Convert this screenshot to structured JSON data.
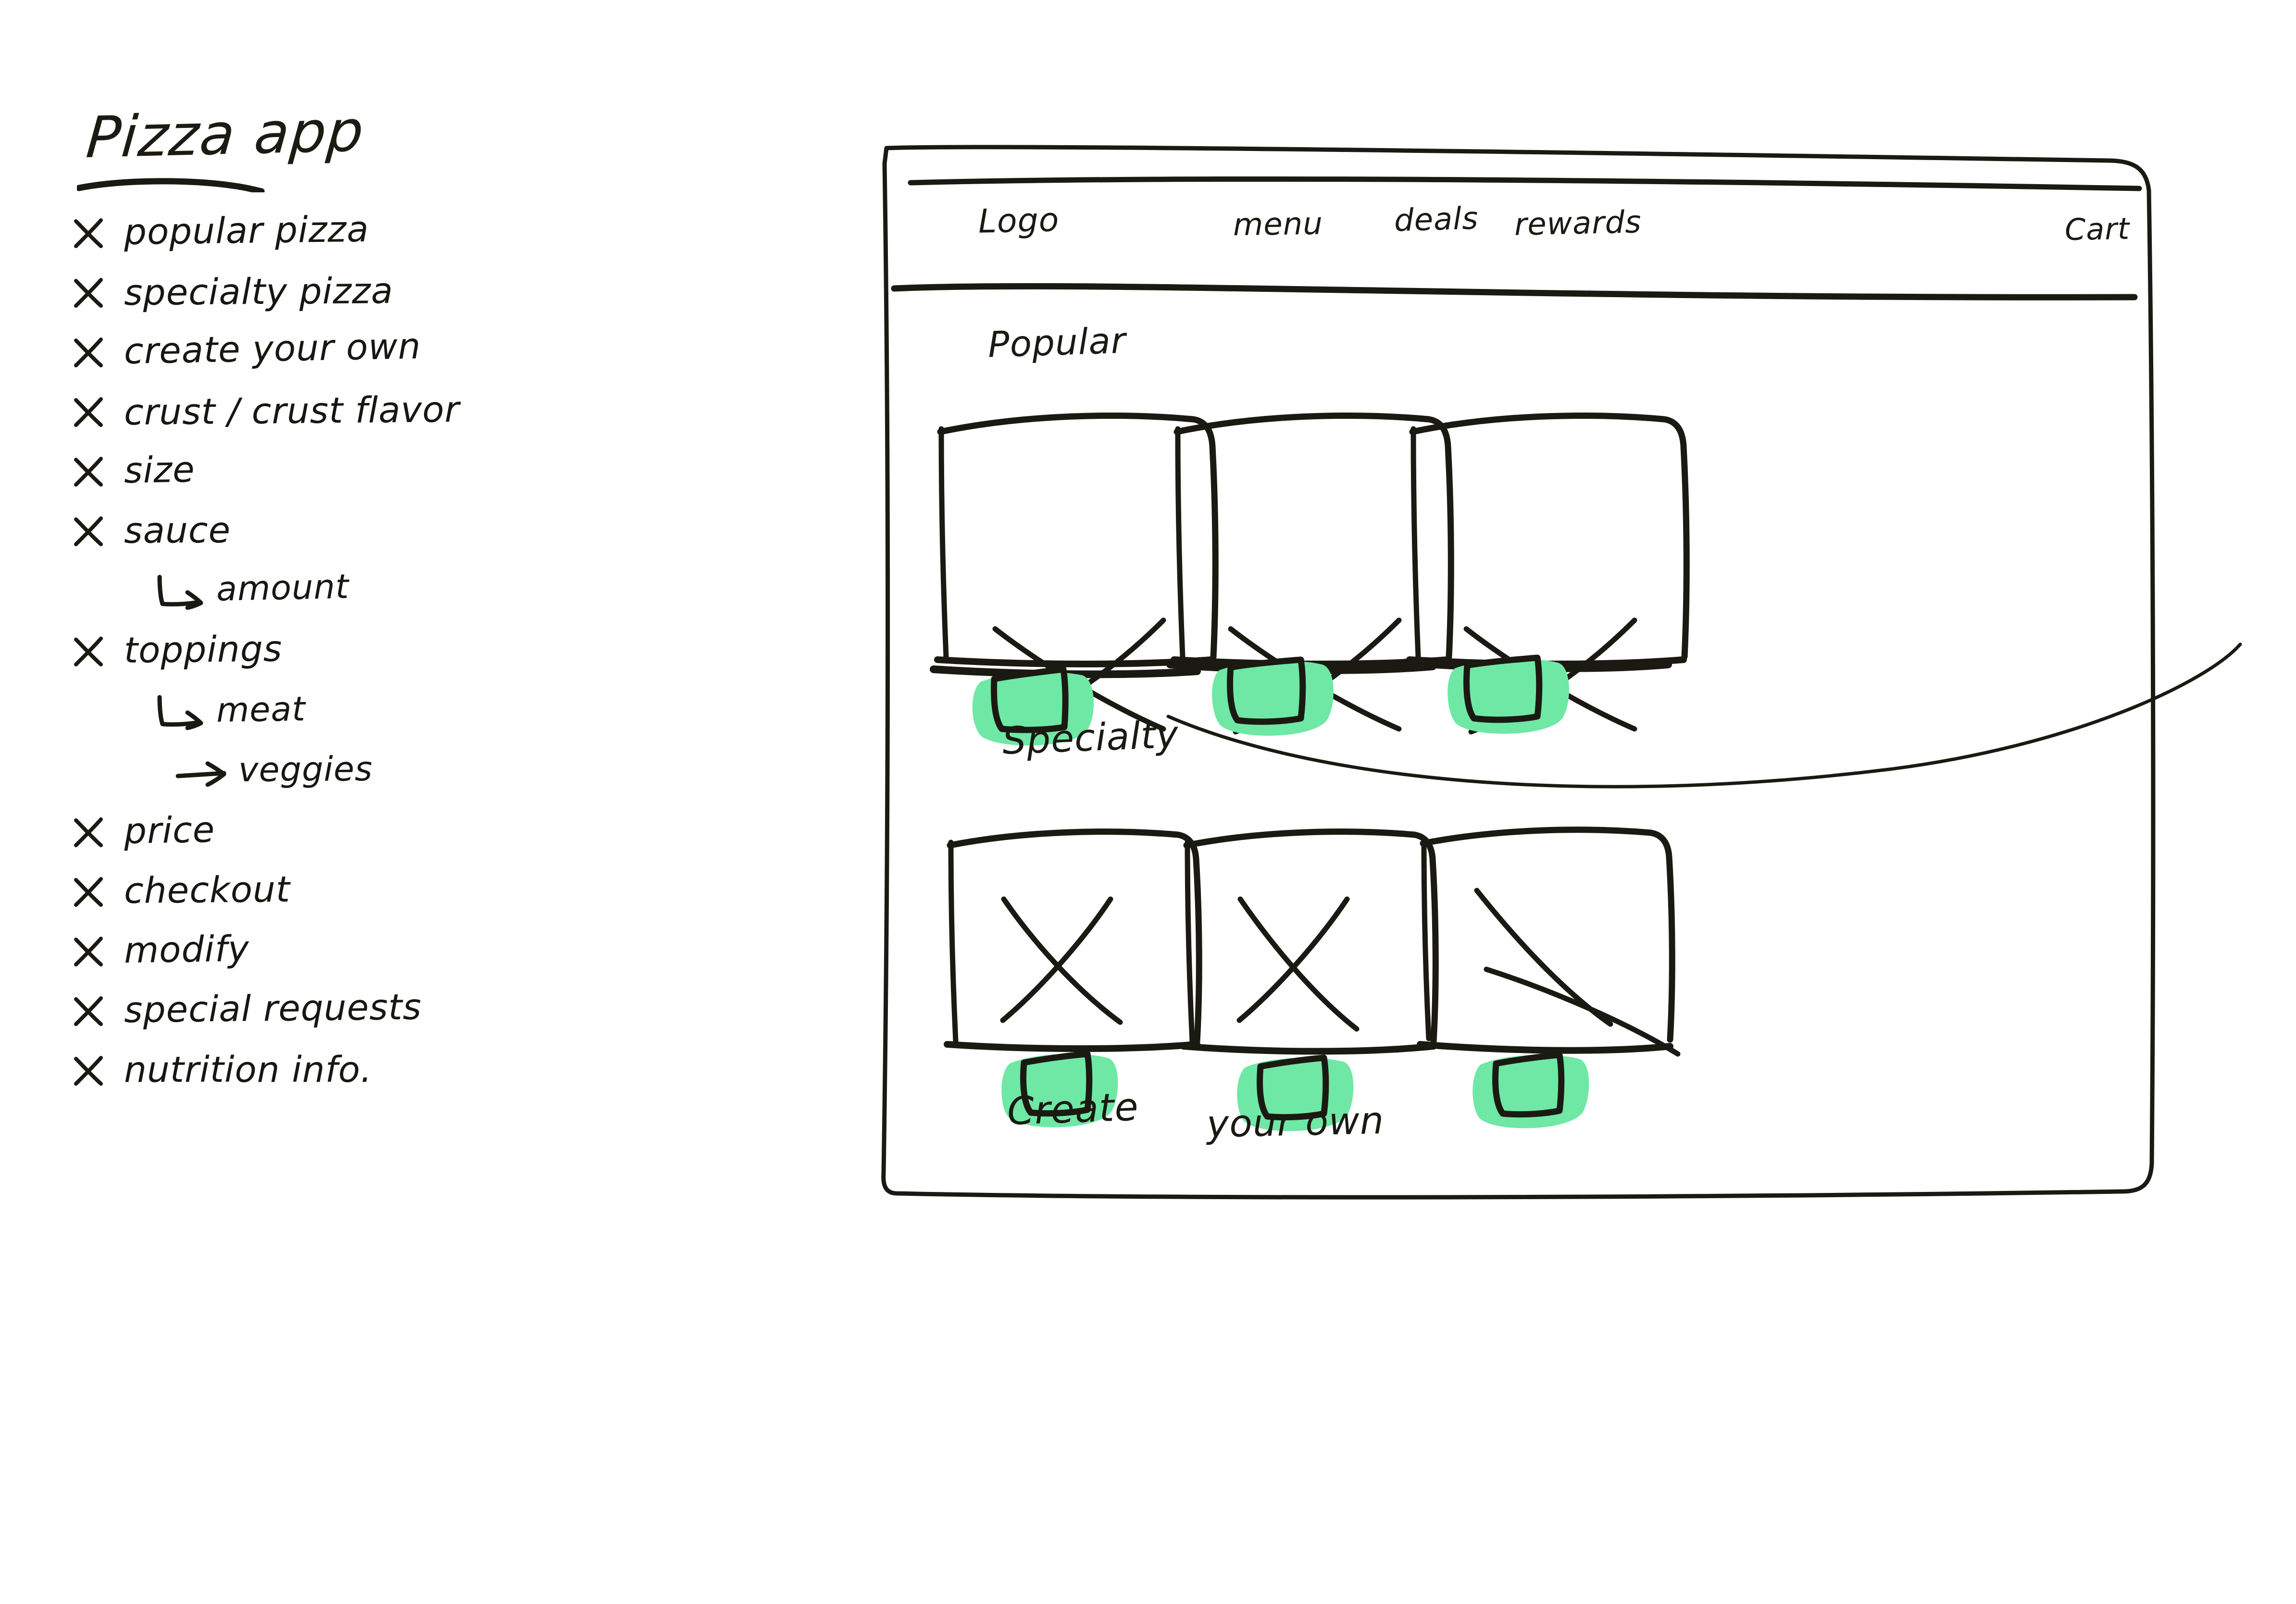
{
  "sketch": {
    "title": "Pizza app",
    "checklist": [
      {
        "level": 0,
        "mark": "x-mark",
        "label": "popular pizza"
      },
      {
        "level": 0,
        "mark": "x-mark",
        "label": "specialty pizza"
      },
      {
        "level": 0,
        "mark": "x-mark",
        "label": "create your own"
      },
      {
        "level": 0,
        "mark": "x-mark",
        "label": "crust / crust flavor"
      },
      {
        "level": 0,
        "mark": "x-mark",
        "label": "size"
      },
      {
        "level": 0,
        "mark": "x-mark",
        "label": "sauce"
      },
      {
        "level": 1,
        "mark": "corner-arrow-icon",
        "label": "amount"
      },
      {
        "level": 0,
        "mark": "x-mark",
        "label": "toppings"
      },
      {
        "level": 1,
        "mark": "corner-arrow-icon",
        "label": "meat"
      },
      {
        "level": 1,
        "mark": "right-arrow-icon",
        "label": "veggies"
      },
      {
        "level": 0,
        "mark": "x-mark",
        "label": "price"
      },
      {
        "level": 0,
        "mark": "x-mark",
        "label": "checkout"
      },
      {
        "level": 0,
        "mark": "x-mark",
        "label": "modify"
      },
      {
        "level": 0,
        "mark": "x-mark",
        "label": "special requests"
      },
      {
        "level": 0,
        "mark": "x-mark",
        "label": "nutrition info."
      }
    ]
  },
  "wireframe": {
    "nav": {
      "logo": "Logo",
      "menu": "menu",
      "deals": "deals",
      "rewards": "rewards",
      "cart": "Cart"
    },
    "sections": [
      {
        "heading": "Popular",
        "cards": 3
      },
      {
        "heading": "Specialty",
        "cards": 3
      },
      {
        "heading_part1": "Create",
        "heading_part2": "your own",
        "cards": 0
      }
    ],
    "card": {
      "image_placeholder": "x-cross-placeholder",
      "title_bar": "text-line-placeholder",
      "action_button": "highlighted-button"
    }
  },
  "colors": {
    "ink": "#1a1a12",
    "highlight_green": "#6FE8A5",
    "paper": "#ffffff"
  }
}
